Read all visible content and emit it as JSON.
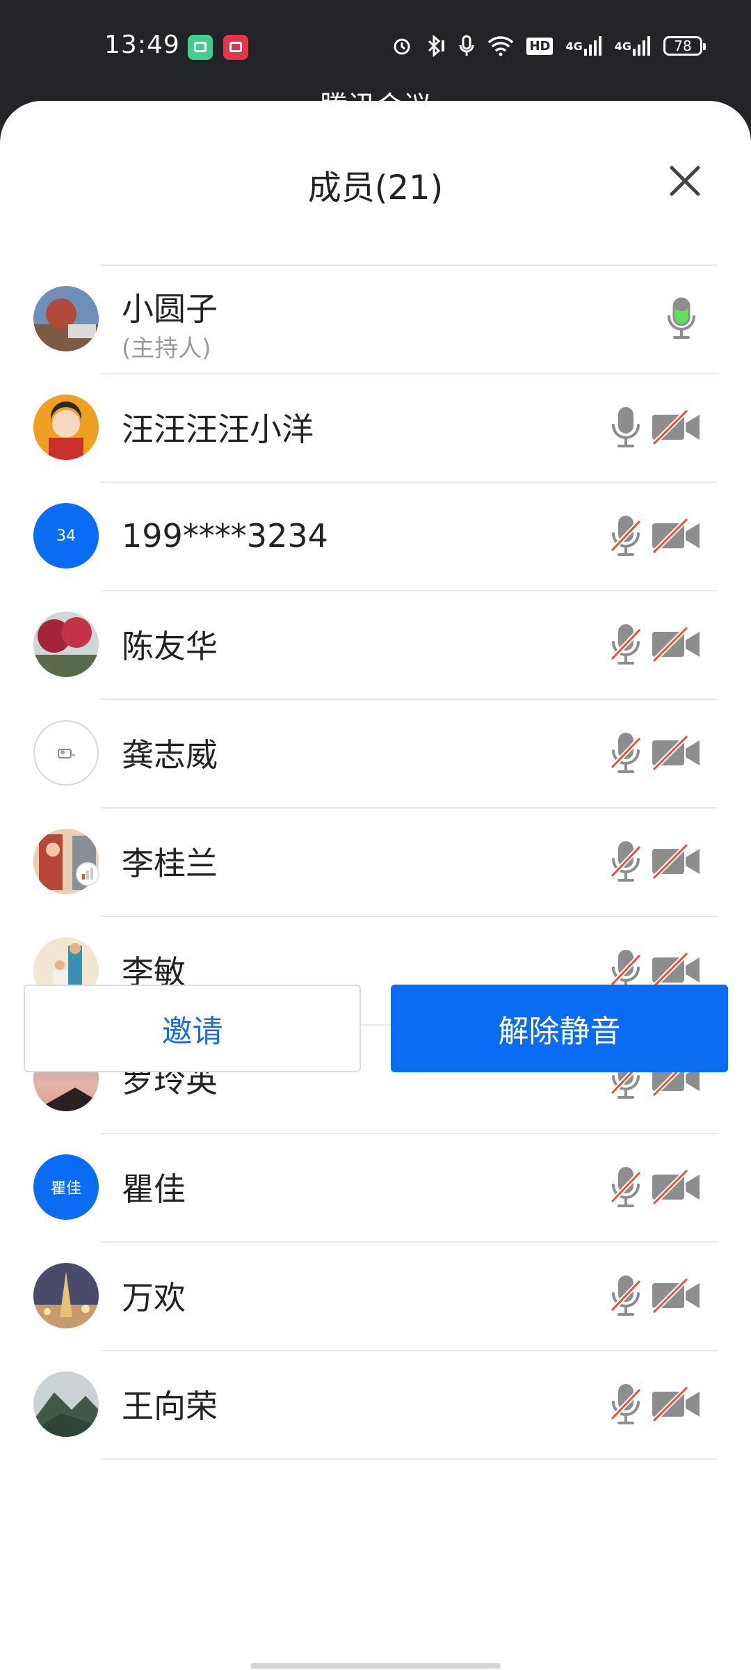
{
  "status_bar": {
    "time": "13:49",
    "battery": "78",
    "icons": [
      "alarm-icon",
      "bluetooth-icon",
      "mic-icon",
      "wifi-icon",
      "hd-icon",
      "signal-4g-icon",
      "signal-4g-icon",
      "battery-icon"
    ],
    "hd_label": "HD",
    "net1": "4G",
    "net2": "4G"
  },
  "behind_title": "腾讯会议",
  "sheet": {
    "title": "成员(21)"
  },
  "members": [
    {
      "name": "小圆子",
      "role": "(主持人)",
      "avatar": "photo",
      "mic": "active",
      "cam": "none"
    },
    {
      "name": "汪汪汪汪小洋",
      "avatar": "photo",
      "mic": "on",
      "cam": "off"
    },
    {
      "name": "199****3234",
      "avatar": "text",
      "avatar_text": "34",
      "mic": "muted",
      "cam": "off"
    },
    {
      "name": "陈友华",
      "avatar": "photo",
      "mic": "muted",
      "cam": "off"
    },
    {
      "name": "龚志威",
      "avatar": "outline",
      "mic": "muted",
      "cam": "off"
    },
    {
      "name": "李桂兰",
      "avatar": "photo",
      "mic": "muted",
      "cam": "off"
    },
    {
      "name": "李敏",
      "avatar": "photo",
      "mic": "muted",
      "cam": "off"
    },
    {
      "name": "罗玲英",
      "avatar": "photo",
      "mic": "muted",
      "cam": "off"
    },
    {
      "name": "瞿佳",
      "avatar": "text",
      "avatar_text": "瞿佳",
      "mic": "muted",
      "cam": "off"
    },
    {
      "name": "万欢",
      "avatar": "photo",
      "mic": "muted",
      "cam": "off"
    },
    {
      "name": "王向荣",
      "avatar": "photo",
      "mic": "muted",
      "cam": "off"
    }
  ],
  "buttons": {
    "invite": "邀请",
    "unmute": "解除静音"
  },
  "colors": {
    "accent": "#0a6cf3",
    "mic_active": "#5ee25a",
    "muted_slash": "#e8503a",
    "icon_gray": "#8d8d8d"
  }
}
